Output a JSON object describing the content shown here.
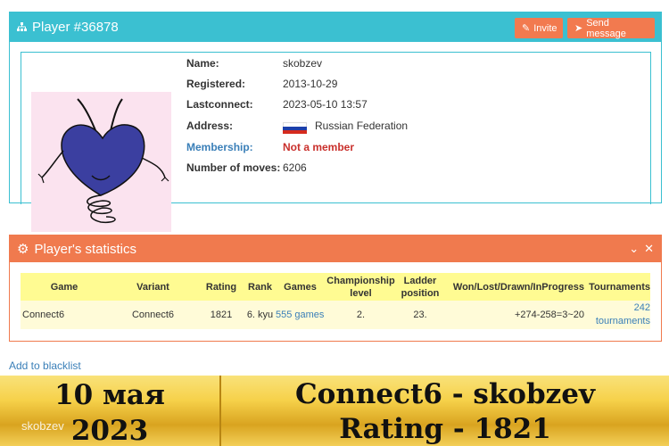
{
  "player": {
    "title": "Player #36878",
    "invite_label": "Invite",
    "message_label": "Send message",
    "fields": {
      "name_label": "Name:",
      "name": "skobzev",
      "registered_label": "Registered:",
      "registered": "2013-10-29",
      "lastconnect_label": "Lastconnect:",
      "lastconnect": "2023-05-10 13:57",
      "address_label": "Address:",
      "address": "Russian Federation",
      "membership_label": "Membership:",
      "membership": "Not a member",
      "moves_label": "Number of moves:",
      "moves": "6206"
    }
  },
  "stats": {
    "title": "Player's statistics",
    "headers": [
      "Game",
      "Variant",
      "Rating",
      "Rank",
      "Games",
      "Championship level",
      "Ladder position",
      "Won/Lost/Drawn/InProgress",
      "Tournaments"
    ],
    "row": {
      "game": "Connect6",
      "variant": "Connect6",
      "rating": "1821",
      "rank": "6. kyu",
      "games": "555 games",
      "championship": "2.",
      "ladder": "23.",
      "wldp": "+274-258=3~20",
      "tournaments": "242 tournaments"
    }
  },
  "blacklist_label": "Add to blacklist",
  "banner": {
    "date_line1": "10 мая",
    "date_line2": "2023",
    "title_line1": "Connect6 - skobzev",
    "title_line2": "Rating - 1821",
    "watermark": "skobzev"
  },
  "colors": {
    "teal": "#3bc0d1",
    "orange": "#f07a4e",
    "link": "#3a7fb8",
    "red": "#c9302c"
  }
}
